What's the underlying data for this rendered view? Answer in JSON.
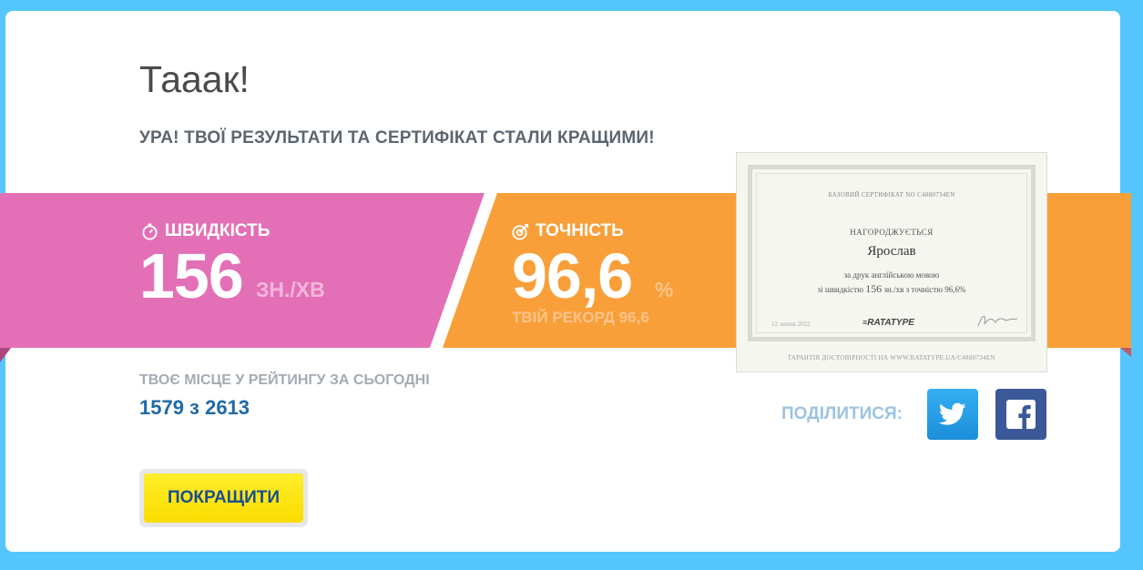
{
  "header": {
    "title": "Тааак!",
    "subtitle": "УРА! ТВОЇ РЕЗУЛЬТАТИ ТА СЕРТИФІКАТ СТАЛИ КРАЩИМИ!"
  },
  "speed": {
    "label": "ШВИДКІСТЬ",
    "value": "156",
    "unit": "ЗН./ХВ",
    "color": "#e370b6"
  },
  "accuracy": {
    "label": "ТОЧНІСТЬ",
    "value": "96,6",
    "unit": "%",
    "record": "ТВІЙ РЕКОРД 96,6",
    "color": "#f99f3a"
  },
  "certificate": {
    "number_line": "БАЗОВИЙ СЕРТИФІКАТ NO C4880734EN",
    "awarded": "НАГОРОДЖУЄТЬСЯ",
    "name": "Ярослав",
    "line1": "за друк англійською мовою",
    "line2_prefix": "зі швидкістю",
    "line2_speed": "156",
    "line2_suffix": "зн./хв з точністю 96,6%",
    "date": "12 липня 2022",
    "brand": "RATATYPE",
    "verify": "ГАРАНТІЯ ДОСТОВІРНОСТІ НА WWW.RATATYPE.UA/C4880734EN"
  },
  "rank": {
    "label": "ТВОЄ МІСЦЕ У РЕЙТИНГУ ЗА СЬОГОДНІ",
    "value": "1579 з 2613"
  },
  "share": {
    "label": "ПОДІЛИТИСЯ:",
    "twitter_color": "#2d9fe8",
    "facebook_color": "#3b5998"
  },
  "actions": {
    "improve_label": "ПОКРАЩИТИ"
  }
}
